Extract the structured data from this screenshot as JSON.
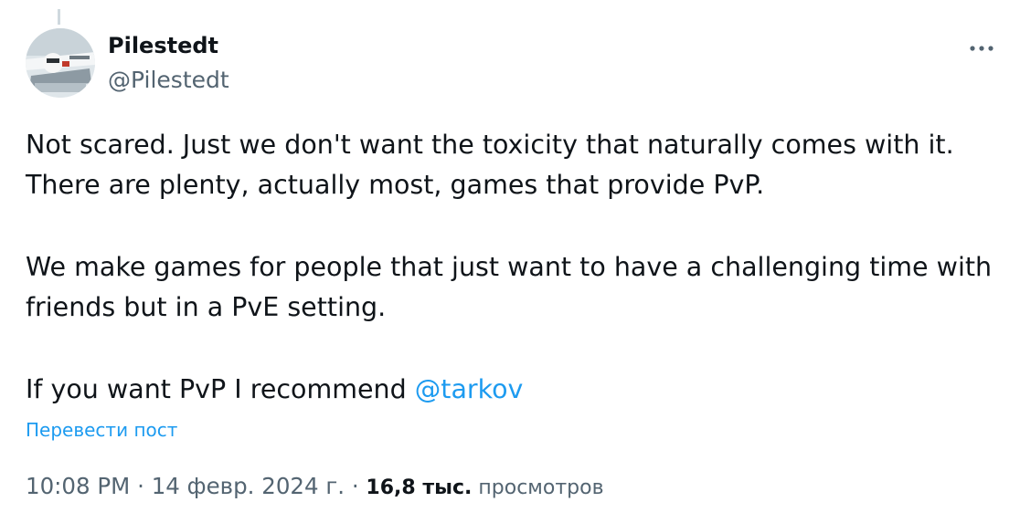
{
  "author": {
    "display_name": "Pilestedt",
    "handle": "@Pilestedt"
  },
  "tweet": {
    "line1": "Not scared. Just we don't want the toxicity that naturally comes with it.",
    "line2": "There are plenty, actually most, games that provide PvP.",
    "line3": "We make games for people that just want to have a challenging time with",
    "line4": "friends but in a PvE setting.",
    "line5_text": "If you want PvP I recommend ",
    "line5_mention": "@tarkov"
  },
  "translate_label": "Перевести пост",
  "meta": {
    "time": "10:08 PM",
    "sep1": " · ",
    "date": "14 февр. 2024 г.",
    "sep2": " · ",
    "views_count": "16,8 тыс.",
    "views_label": " просмотров"
  },
  "icons": {
    "more": "more-horizontal-icon"
  },
  "colors": {
    "link": "#1d9bf0",
    "secondary": "#536471",
    "primary": "#0f1419"
  }
}
